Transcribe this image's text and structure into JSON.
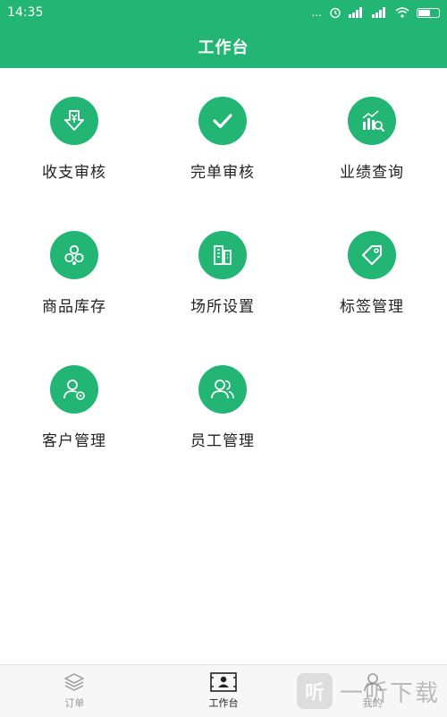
{
  "status_bar": {
    "time": "14:35",
    "dots": "...",
    "icons": [
      "alarm-icon",
      "signal-icon",
      "signal-icon",
      "wifi-icon",
      "battery-icon"
    ]
  },
  "header": {
    "title": "工作台",
    "background_color": "#22b573"
  },
  "grid": {
    "accent_color": "#22b573",
    "items": [
      {
        "label": "收支审核",
        "icon": "income-expense-review-icon"
      },
      {
        "label": "完单审核",
        "icon": "checkmark-icon"
      },
      {
        "label": "业绩查询",
        "icon": "performance-chart-icon"
      },
      {
        "label": "商品库存",
        "icon": "goods-stack-icon"
      },
      {
        "label": "场所设置",
        "icon": "buildings-icon"
      },
      {
        "label": "标签管理",
        "icon": "tag-icon"
      },
      {
        "label": "客户管理",
        "icon": "customer-icon"
      },
      {
        "label": "员工管理",
        "icon": "staff-icon"
      }
    ]
  },
  "tabbar": {
    "tabs": [
      {
        "label": "订单",
        "icon": "layers-icon",
        "active": false
      },
      {
        "label": "工作台",
        "icon": "workbench-icon",
        "active": true
      },
      {
        "label": "我的",
        "icon": "person-icon",
        "active": false
      }
    ]
  },
  "watermark": {
    "logo_text": "听",
    "text": "一听下载"
  }
}
